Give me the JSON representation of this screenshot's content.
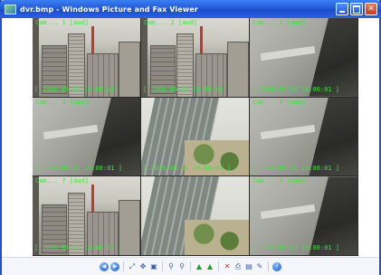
{
  "window": {
    "title": "dvr.bmp - Windows Picture and Fax Viewer",
    "controls": [
      "minimize",
      "maximize",
      "close"
    ]
  },
  "cameras": [
    {
      "label": "Cam... 1 [aud]",
      "timestamp": "[ 2006-06-12 10:00:01 ]",
      "scene": "city"
    },
    {
      "label": "Cam... 2 [aud]",
      "timestamp": "[ 2006-06-12 10:00:01 ]",
      "scene": "city"
    },
    {
      "label": "Cam... 3 [aud]",
      "timestamp": "[ 2006-06-12 10:00:01 ]",
      "scene": "closeup"
    },
    {
      "label": "Cam... 4 [aud]",
      "timestamp": "[ 2006-06-12 10:00:01 ]",
      "scene": "closeup"
    },
    {
      "label": "",
      "timestamp": "[ 2006-06-12 10:00:01 ]",
      "scene": "tower"
    },
    {
      "label": "Cam... 6 [aud]",
      "timestamp": "[ 2006-06-12 10:00:01 ]",
      "scene": "closeup"
    },
    {
      "label": "Cam... 7 [aud]",
      "timestamp": "[ 2006-06-12 10:00:01 ]",
      "scene": "city"
    },
    {
      "label": "",
      "timestamp": "",
      "scene": "tower"
    },
    {
      "label": "Cam... 9 [aud]",
      "timestamp": "[ 2006-06-12 10:00:01 ]",
      "scene": "closeup"
    }
  ],
  "toolbar": {
    "buttons": [
      "previous-image-icon",
      "next-image-icon",
      "best-fit-icon",
      "actual-size-icon",
      "slideshow-icon",
      "zoom-in-icon",
      "zoom-out-icon",
      "rotate-clockwise-icon",
      "rotate-counterclockwise-icon",
      "delete-icon",
      "print-icon",
      "save-icon",
      "open-editor-icon",
      "help-icon"
    ]
  },
  "colors": {
    "titlebar": "#2459d9",
    "overlay_text": "#3fe23f",
    "toolbar_bg": "#f4f6fb"
  }
}
